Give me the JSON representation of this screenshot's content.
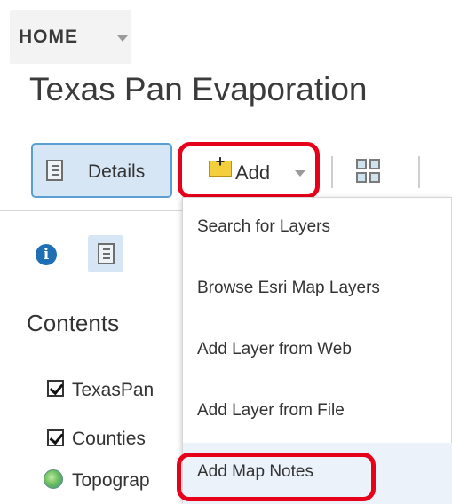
{
  "breadcrumb": {
    "home_label": "HOME"
  },
  "page": {
    "title": "Texas Pan Evaporation"
  },
  "toolbar": {
    "details_label": "Details",
    "add_label": "Add"
  },
  "add_menu": {
    "items": [
      {
        "label": "Search for Layers"
      },
      {
        "label": "Browse Esri Map Layers"
      },
      {
        "label": "Add Layer from Web"
      },
      {
        "label": "Add Layer from File"
      },
      {
        "label": "Add Map Notes"
      }
    ],
    "active_item": "Add Map Notes"
  },
  "contents": {
    "heading": "Contents",
    "layers": [
      {
        "label": "TexasPan",
        "checked": true
      },
      {
        "label": "Counties",
        "checked": true
      },
      {
        "label": "Topograp",
        "icon": "globe-icon"
      }
    ]
  },
  "colors": {
    "highlight": "#e6001a",
    "selected_bg": "#d6e6f5",
    "selected_border": "#5a9fd4",
    "info": "#1f6fb5"
  }
}
